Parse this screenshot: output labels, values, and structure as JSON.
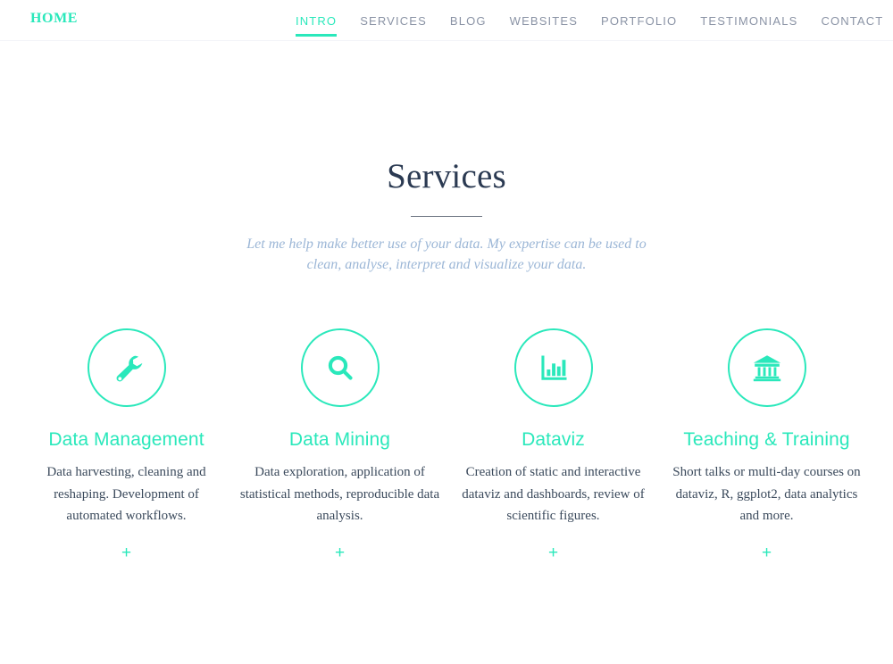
{
  "theme": {
    "accent": "#2ae8bb",
    "nav_text": "#8a93a5",
    "heading": "#2b3a52",
    "body_text": "#3b4a5c",
    "subtitle": "#9bb6d6",
    "background": "#ffffff"
  },
  "header": {
    "brand": "HOME",
    "nav": [
      {
        "label": "INTRO",
        "active": true
      },
      {
        "label": "SERVICES",
        "active": false
      },
      {
        "label": "BLOG",
        "active": false
      },
      {
        "label": "WEBSITES",
        "active": false
      },
      {
        "label": "PORTFOLIO",
        "active": false
      },
      {
        "label": "TESTIMONIALS",
        "active": false
      },
      {
        "label": "CONTACT",
        "active": false
      }
    ]
  },
  "section": {
    "title": "Services",
    "subtitle_line1": "Let me help make better use of your data. My expertise can be used",
    "subtitle_line2": "to clean, analyse, interpret and visualize your data."
  },
  "services": [
    {
      "icon": "wrench-icon",
      "title": "Data Management",
      "description": "Data harvesting, cleaning and reshaping. Development of automated workflows.",
      "expand_label": "+"
    },
    {
      "icon": "magnifier-icon",
      "title": "Data Mining",
      "description": "Data exploration, application of statistical methods, reproducible data analysis.",
      "expand_label": "+"
    },
    {
      "icon": "bar-chart-icon",
      "title": "Dataviz",
      "description": "Creation of static and interactive dataviz and dashboards, review of scientific figures.",
      "expand_label": "+"
    },
    {
      "icon": "bank-icon",
      "title": "Teaching & Training",
      "description": "Short talks or multi-day courses on dataviz, R, ggplot2, data analytics and more.",
      "expand_label": "+"
    }
  ]
}
